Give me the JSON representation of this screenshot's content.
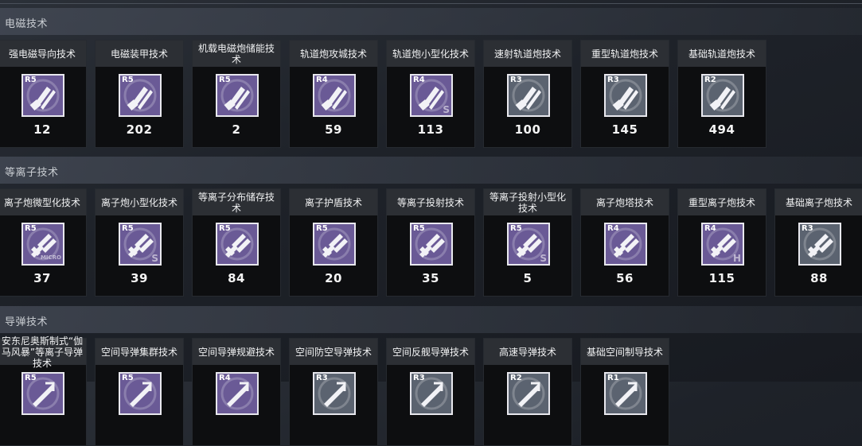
{
  "sections": [
    {
      "title": "电磁技术",
      "icon": "railgun-icon",
      "cards": [
        {
          "name": "强电磁导向技术",
          "rank": "R5",
          "count": "12",
          "badge": "",
          "color": "#6a5a96"
        },
        {
          "name": "电磁装甲技术",
          "rank": "R5",
          "count": "202",
          "badge": "",
          "color": "#6a5a96"
        },
        {
          "name": "机载电磁炮储能技术",
          "rank": "R5",
          "count": "2",
          "badge": "",
          "color": "#6a5a96"
        },
        {
          "name": "轨道炮攻城技术",
          "rank": "R4",
          "count": "59",
          "badge": "",
          "color": "#6a5a96"
        },
        {
          "name": "轨道炮小型化技术",
          "rank": "R4",
          "count": "113",
          "badge": "S",
          "color": "#6a5a96"
        },
        {
          "name": "速射轨道炮技术",
          "rank": "R3",
          "count": "100",
          "badge": "",
          "color": "#5b6370"
        },
        {
          "name": "重型轨道炮技术",
          "rank": "R3",
          "count": "145",
          "badge": "",
          "color": "#5b6370"
        },
        {
          "name": "基础轨道炮技术",
          "rank": "R2",
          "count": "494",
          "badge": "",
          "color": "#5b6370"
        }
      ]
    },
    {
      "title": "等离子技术",
      "icon": "plasma-cannon-icon",
      "cards": [
        {
          "name": "离子炮微型化技术",
          "rank": "R5",
          "count": "37",
          "badge": "MICRO",
          "color": "#6a5a96"
        },
        {
          "name": "离子炮小型化技术",
          "rank": "R5",
          "count": "39",
          "badge": "S",
          "color": "#6a5a96"
        },
        {
          "name": "等离子分布储存技术",
          "rank": "R5",
          "count": "84",
          "badge": "",
          "color": "#6a5a96"
        },
        {
          "name": "离子护盾技术",
          "rank": "R5",
          "count": "20",
          "badge": "",
          "color": "#6a5a96"
        },
        {
          "name": "等离子投射技术",
          "rank": "R5",
          "count": "35",
          "badge": "",
          "color": "#6a5a96"
        },
        {
          "name": "等离子投射小型化技术",
          "rank": "R5",
          "count": "5",
          "badge": "S",
          "color": "#6a5a96"
        },
        {
          "name": "离子炮塔技术",
          "rank": "R4",
          "count": "56",
          "badge": "",
          "color": "#6a5a96"
        },
        {
          "name": "重型离子炮技术",
          "rank": "R4",
          "count": "115",
          "badge": "H",
          "color": "#6a5a96"
        },
        {
          "name": "基础离子炮技术",
          "rank": "R3",
          "count": "88",
          "badge": "",
          "color": "#5b6370"
        }
      ]
    },
    {
      "title": "导弹技术",
      "icon": "missile-icon",
      "cards": [
        {
          "name": "安东尼奥斯制式“伽马风暴”等离子导弹技术",
          "rank": "R5",
          "count": "",
          "badge": "",
          "color": "#6a5a96"
        },
        {
          "name": "空间导弹集群技术",
          "rank": "R5",
          "count": "",
          "badge": "",
          "color": "#6a5a96"
        },
        {
          "name": "空间导弹规避技术",
          "rank": "R4",
          "count": "",
          "badge": "",
          "color": "#6a5a96"
        },
        {
          "name": "空间防空导弹技术",
          "rank": "R3",
          "count": "",
          "badge": "",
          "color": "#5b6370"
        },
        {
          "name": "空间反舰导弹技术",
          "rank": "R3",
          "count": "",
          "badge": "",
          "color": "#5b6370"
        },
        {
          "name": "高速导弹技术",
          "rank": "R2",
          "count": "",
          "badge": "",
          "color": "#5b6370"
        },
        {
          "name": "基础空间制导技术",
          "rank": "R1",
          "count": "",
          "badge": "",
          "color": "#5b6370"
        }
      ]
    }
  ]
}
